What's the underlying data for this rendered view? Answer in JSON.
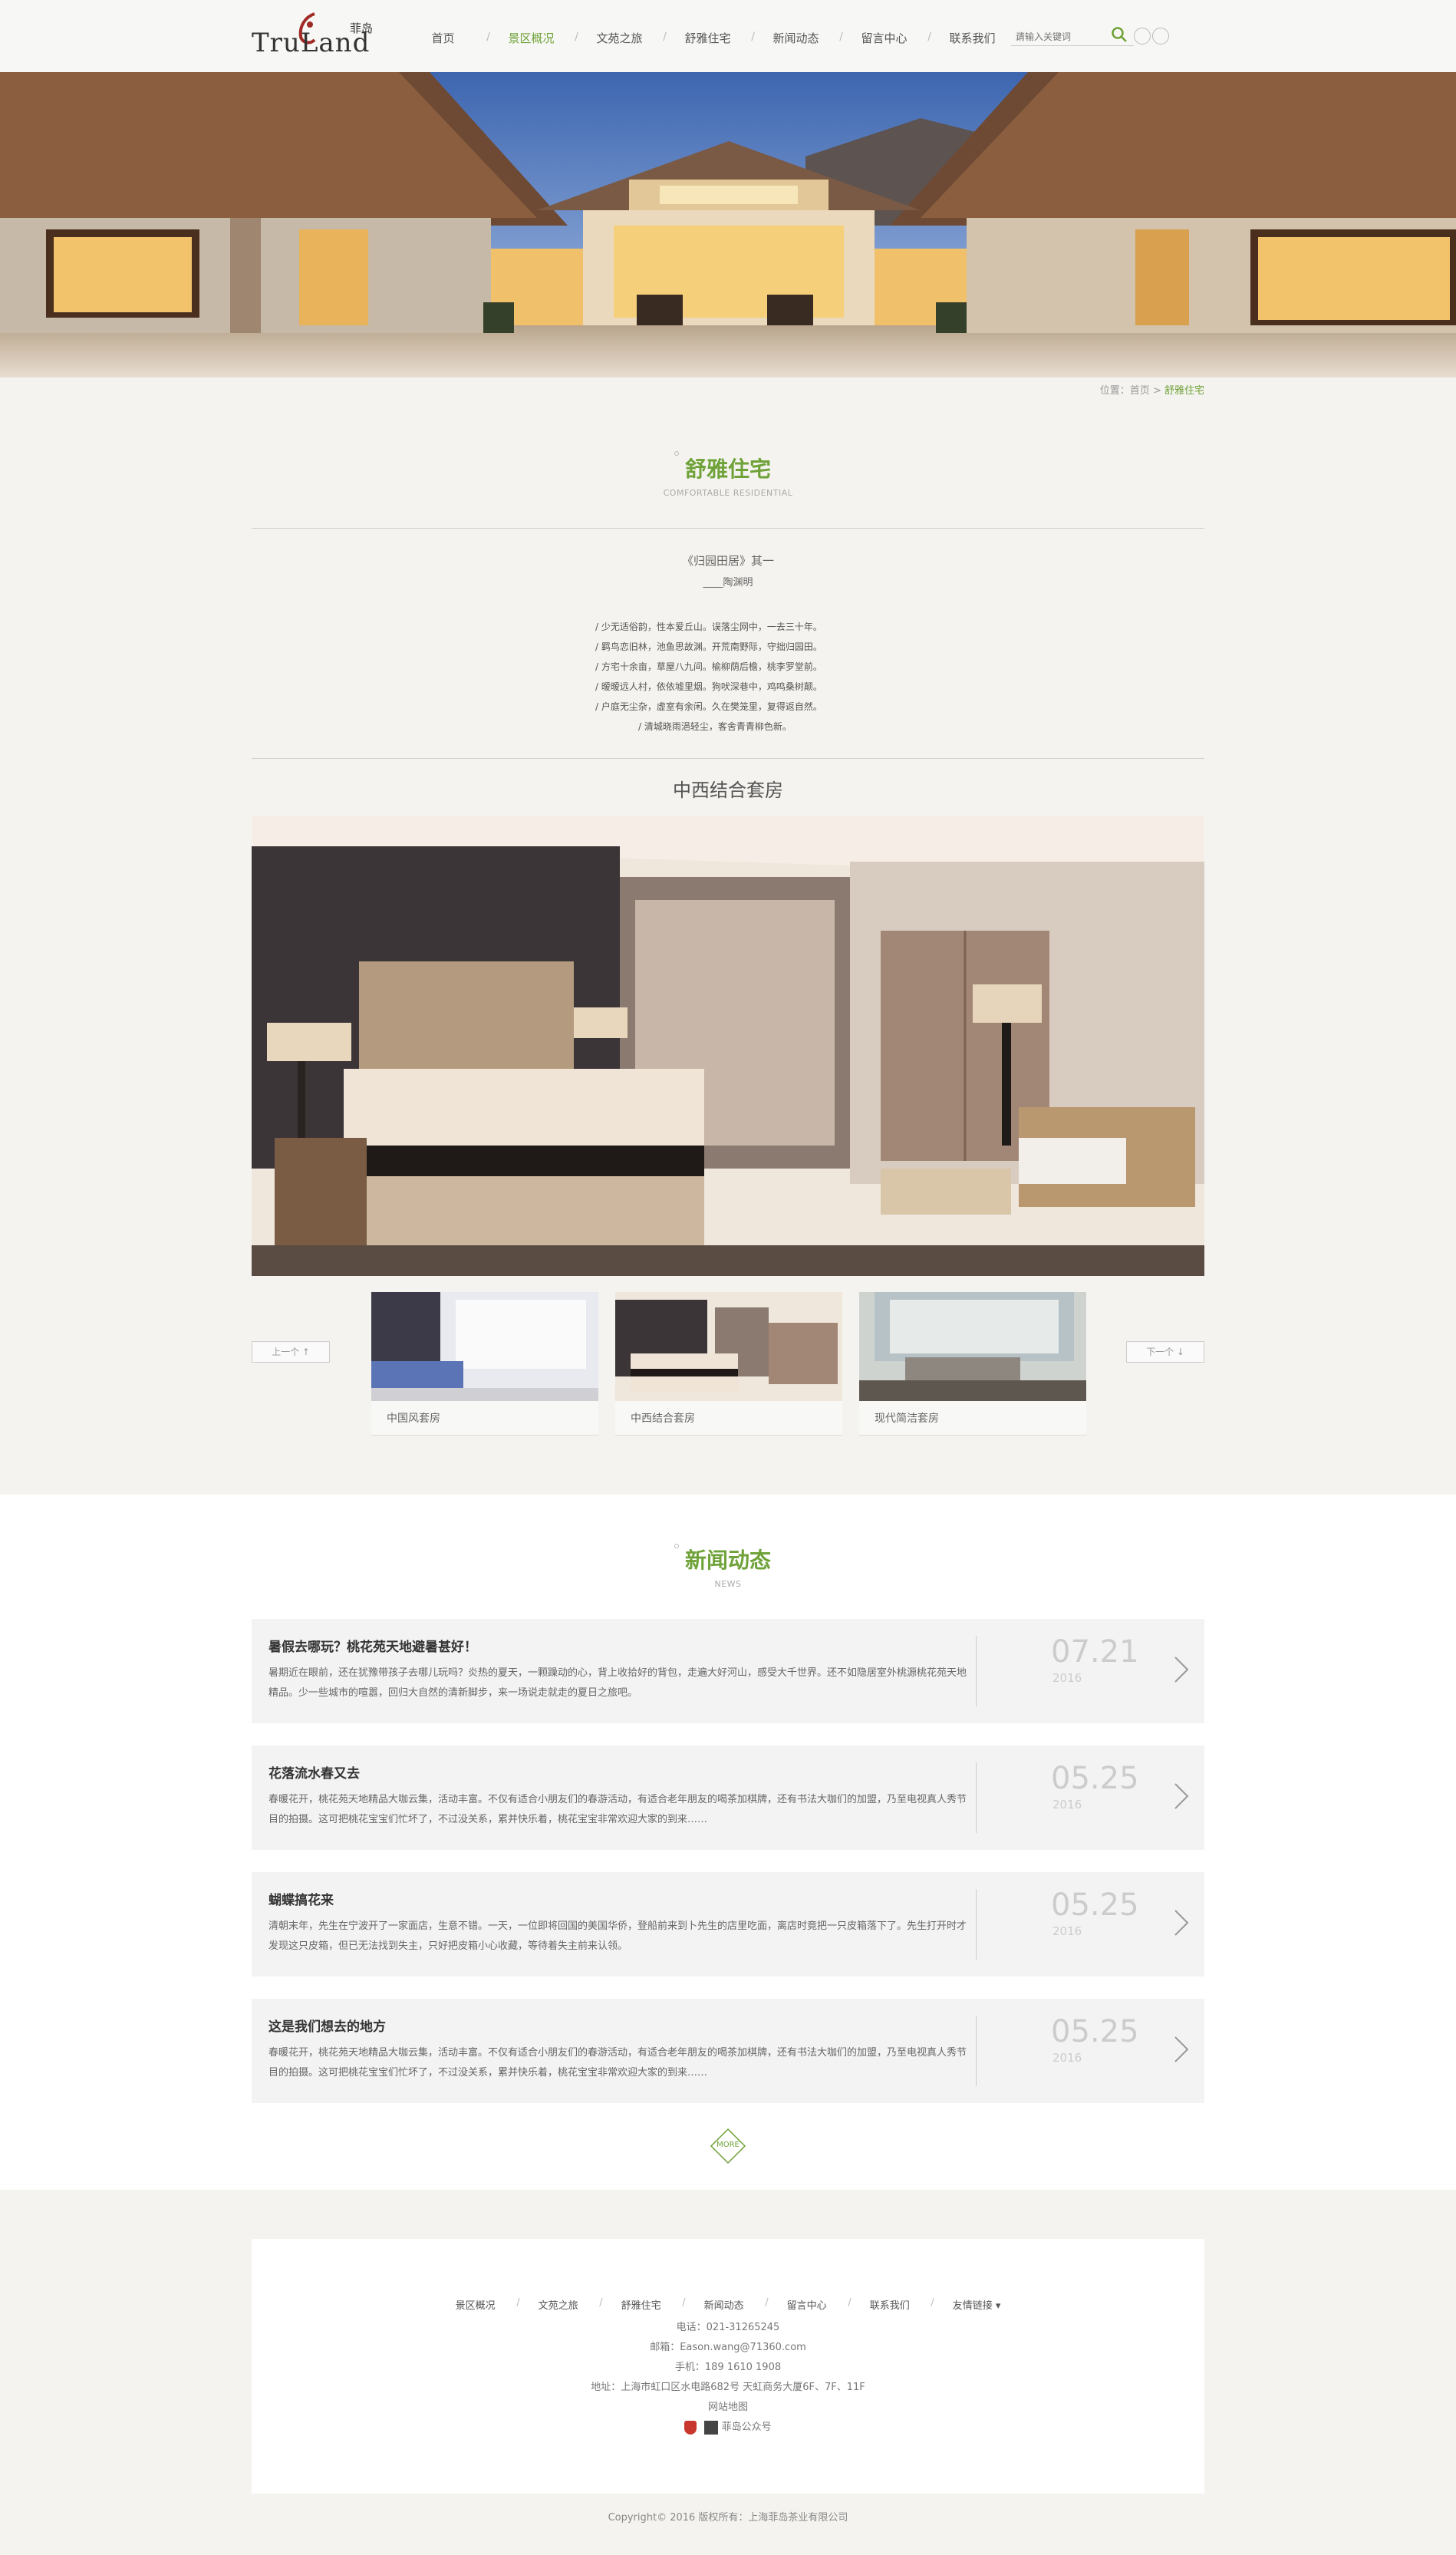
{
  "brand": {
    "logo_text": "TruLand",
    "logo_cn": "菲岛"
  },
  "nav": {
    "items": [
      {
        "label": "首页",
        "active": false
      },
      {
        "label": "景区概况",
        "active": true
      },
      {
        "label": "文苑之旅",
        "active": false
      },
      {
        "label": "舒雅住宅",
        "active": false
      },
      {
        "label": "新闻动态",
        "active": false
      },
      {
        "label": "留言中心",
        "active": false
      },
      {
        "label": "联系我们",
        "active": false
      }
    ],
    "search_placeholder": "请输入关键词"
  },
  "breadcrumb": {
    "prefix": "位置：",
    "home": "首页",
    "sep": ">",
    "current": "舒雅住宅"
  },
  "section_residence": {
    "title": "舒雅住宅",
    "subtitle": "COMFORTABLE RESIDENTIAL"
  },
  "poem": {
    "title": "《归园田居》其一",
    "author": "____陶渊明",
    "lines": [
      "/ 少无适俗韵，性本爱丘山。误落尘网中，一去三十年。",
      "/ 羁鸟恋旧林，池鱼思故渊。开荒南野际，守拙归园田。",
      "/ 方宅十余亩，草屋八九间。榆柳荫后檐，桃李罗堂前。",
      "/ 暧暧远人村，依依墟里烟。狗吠深巷中，鸡鸣桑树颠。",
      "/ 户庭无尘杂，虚室有余闲。久在樊笼里，复得返自然。",
      "/ 清城晓雨浥轻尘，客舍青青柳色新。"
    ]
  },
  "room": {
    "title": "中西结合套房",
    "prev_label": "上一个 ↑",
    "next_label": "下一个 ↓",
    "thumbs": [
      "中国风套房",
      "中西结合套房",
      "现代简洁套房"
    ]
  },
  "section_news": {
    "title": "新闻动态",
    "subtitle": "NEWS"
  },
  "news": [
    {
      "title": "暑假去哪玩？桃花苑天地避暑甚好！",
      "desc": "暑期近在眼前，还在犹豫带孩子去哪儿玩吗？炎热的夏天，一颗躁动的心，背上收拾好的背包，走遍大好河山，感受大千世界。还不如隐居室外桃源桃花苑天地精品。少一些城市的喧嚣，回归大自然的清新脚步，来一场说走就走的夏日之旅吧。",
      "date": "07.21",
      "year": "2016"
    },
    {
      "title": "花落流水春又去",
      "desc": "春暖花开，桃花苑天地精品大咖云集，活动丰富。不仅有适合小朋友们的春游活动，有适合老年朋友的喝茶加棋牌，还有书法大咖们的加盟，乃至电视真人秀节目的拍摄。这可把桃花宝宝们忙坏了，不过没关系，累并快乐着，桃花宝宝非常欢迎大家的到来……",
      "date": "05.25",
      "year": "2016"
    },
    {
      "title": "蝴蝶搞花来",
      "desc": "清朝末年，先生在宁波开了一家面店，生意不错。一天，一位即将回国的美国华侨，登船前来到卜先生的店里吃面，离店时竟把一只皮箱落下了。先生打开时才发现这只皮箱，但已无法找到失主，只好把皮箱小心收藏，等待着失主前来认领。",
      "date": "05.25",
      "year": "2016"
    },
    {
      "title": "这是我们想去的地方",
      "desc": "春暖花开，桃花苑天地精品大咖云集，活动丰富。不仅有适合小朋友们的春游活动，有适合老年朋友的喝茶加棋牌，还有书法大咖们的加盟，乃至电视真人秀节目的拍摄。这可把桃花宝宝们忙坏了，不过没关系，累并快乐着，桃花宝宝非常欢迎大家的到来……",
      "date": "05.25",
      "year": "2016"
    }
  ],
  "more_label": "MORE",
  "footer": {
    "nav": [
      "景区概况",
      "文苑之旅",
      "舒雅住宅",
      "新闻动态",
      "留言中心",
      "联系我们",
      "友情链接 ▾"
    ],
    "phone": "电话：021-31265245",
    "email": "邮箱：Eason.wang@71360.com",
    "mobile": "手机：189 1610 1908",
    "address": "地址：上海市虹口区水电路682号 天虹商务大厦6F、7F、11F",
    "sitemap": "网站地图",
    "wechat": "菲岛公众号",
    "copyright": "Copyright© 2016 版权所有：上海菲岛茶业有限公司"
  },
  "colors": {
    "accent": "#6fa238",
    "page_bg": "#f4f3ef"
  }
}
